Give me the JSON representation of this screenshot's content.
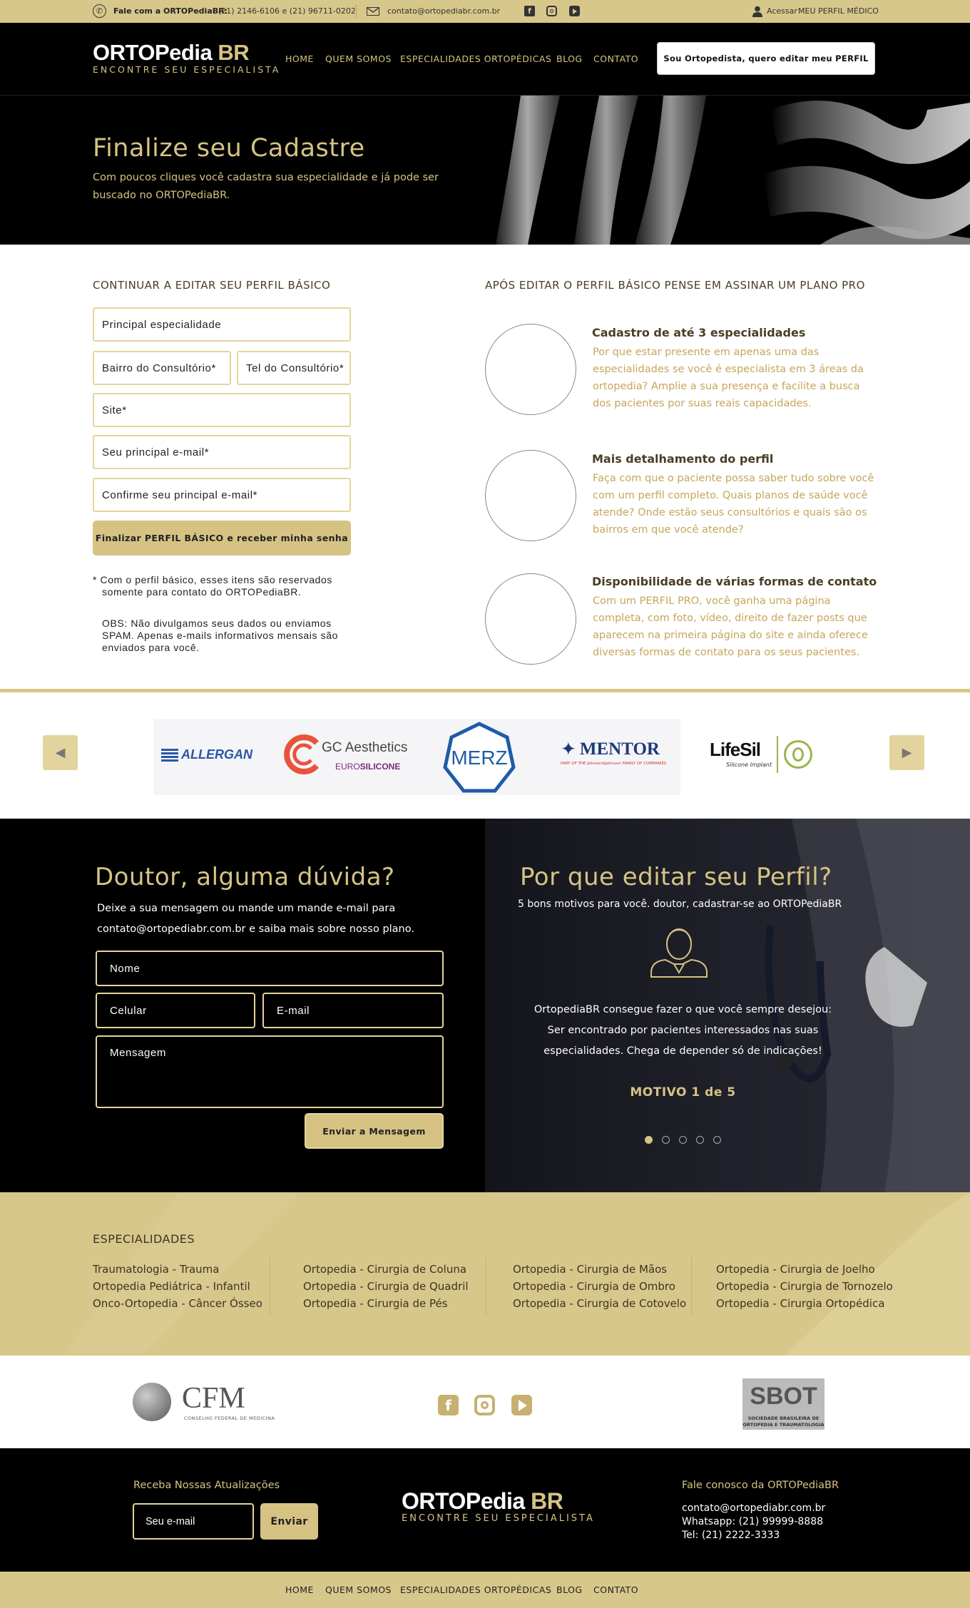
{
  "topbar": {
    "phone_label": "Fale com a ORTOPediaBR:",
    "phones": "(21) 2146-6106 e (21) 96711-0202",
    "email": "contato@ortopediabr.com.br",
    "access_label": "Acessar",
    "profile_link": "MEU PERFIL MÉDICO"
  },
  "brand": {
    "name_main": "ORTOPedia",
    "name_suffix": "BR",
    "tagline": "ENCONTRE SEU ESPECIALISTA"
  },
  "nav": {
    "home": "HOME",
    "about": "QUEM SOMOS",
    "specialties": "ESPECIALIDADES ORTOPÉDICAS",
    "blog": "BLOG",
    "contact": "CONTATO"
  },
  "header_cta": "Sou Ortopedista, quero editar meu PERFIL",
  "hero": {
    "title": "Finalize seu Cadastre",
    "subtitle": "Com poucos cliques você cadastra sua especialidade e já pode ser buscado no ORTOPediaBR."
  },
  "profile_form": {
    "title": "CONTINUAR A EDITAR SEU PERFIL BÁSICO",
    "specialty": "Principal especialidade",
    "neighborhood": "Bairro do Consultório*",
    "office_phone": "Tel do Consultório*",
    "site": "Site*",
    "email": "Seu principal e-mail*",
    "email_confirm": "Confirme seu principal e-mail*",
    "submit": "Finalizar PERFIL BÁSICO e receber minha senha",
    "note_1": "* Com o perfil básico, esses itens são reservados somente para contato do ORTOPediaBR.",
    "note_2": "OBS: Não divulgamos seus dados ou enviamos SPAM. Apenas e-mails informativos mensais são enviados para você."
  },
  "pro_plan": {
    "title": "APÓS EDITAR O PERFIL BÁSICO PENSE EM ASSINAR UM PLANO PRO",
    "benefits": [
      {
        "title": "Cadastro de até 3 especialidades",
        "text": "Por que estar presente em apenas uma das especialidades se você é especialista em 3 áreas da ortopedia? Amplie a sua presença e facilite a busca dos pacientes por suas reais capacidades."
      },
      {
        "title": "Mais detalhamento do perfil",
        "text": "Faça com que o paciente possa saber tudo sobre você com um perfil completo. Quais planos de saúde você atende? Onde estão seus consultórios e quais são os bairros em que você atende?"
      },
      {
        "title": "Disponibilidade de várias formas de contato",
        "text": "Com um PERFIL PRO, você ganha uma página completa, com foto, vídeo, direito de fazer posts que aparecem na primeira página do site e ainda oferece diversas formas de contato para os seus pacientes."
      }
    ]
  },
  "sponsors": {
    "allergan": "ALLERGAN",
    "gc_top": "GC Aesthetics",
    "gc_bottom_1": "EURO",
    "gc_bottom_2": "SILICONE",
    "merz": "MERZ",
    "mentor": "MENTOR",
    "mentor_sub": "PART OF THE Johnson&Johnson FAMILY OF COMPANIES",
    "lifesil": "LifeSil",
    "lifesil_sub": "Silicone Implant"
  },
  "contact": {
    "title": "Doutor, alguma dúvida?",
    "text_1": "Deixe a sua mensagem ou mande um mande e-mail para",
    "text_2": "contato@ortopediabr.com.br e saiba mais sobre nosso plano.",
    "name": "Nome",
    "phone": "Celular",
    "email": "E-mail",
    "message": "Mensagem",
    "submit": "Enviar a Mensagem"
  },
  "why": {
    "title": "Por que  editar seu Perfil?",
    "subtitle": "5 bons motivos para você. doutor, cadastrar-se ao ORTOPediaBR",
    "line_1": "OrtopediaBR consegue fazer o que você sempre desejou:",
    "line_2": "Ser encontrado por pacientes interessados nas suas",
    "line_3": "especialidades. Chega de depender só de indicações!",
    "counter": "MOTIVO 1 de 5"
  },
  "specialties": {
    "title": "ESPECIALIDADES",
    "col1": [
      "Traumatologia -  Trauma",
      "Ortopedia Pediátrica - Infantil",
      "Onco-Ortopedia - Câncer Ósseo"
    ],
    "col2": [
      "Ortopedia - Cirurgia de Coluna",
      "Ortopedia - Cirurgia de Quadril",
      "Ortopedia - Cirurgia de Pés"
    ],
    "col3": [
      "Ortopedia - Cirurgia de Mãos",
      "Ortopedia - Cirurgia de Ombro",
      "Ortopedia - Cirurgia de Cotovelo"
    ],
    "col4": [
      "Ortopedia - Cirurgia de Joelho",
      "Ortopedia - Cirurgia de Tornozelo",
      "Ortopedia - Cirurgia Ortopédica"
    ]
  },
  "partners": {
    "cfm": "CFM",
    "cfm_sub": "CONSELHO FEDERAL DE MEDICINA",
    "sbot": "SBOT",
    "sbot_sub_1": "SOCIEDADE BRASILEIRA DE",
    "sbot_sub_2": "ORTOPEDIA E TRAUMATOLOGIA"
  },
  "footer": {
    "newsletter_title": "Receba Nossas Atualizações",
    "newsletter_placeholder": "Seu e-mail",
    "newsletter_button": "Enviar",
    "contact_title": "Fale conosco da ORTOPediaBR",
    "contact_email": "contato@ortopediabr.com.br",
    "contact_whatsapp": "Whatsapp: (21) 99999-8888",
    "contact_tel": "Tel: (21) 2222-3333"
  },
  "colors": {
    "gold": "#d8c78b",
    "gold_text": "#d6c384",
    "black": "#000000",
    "brown": "#4a3d25"
  }
}
